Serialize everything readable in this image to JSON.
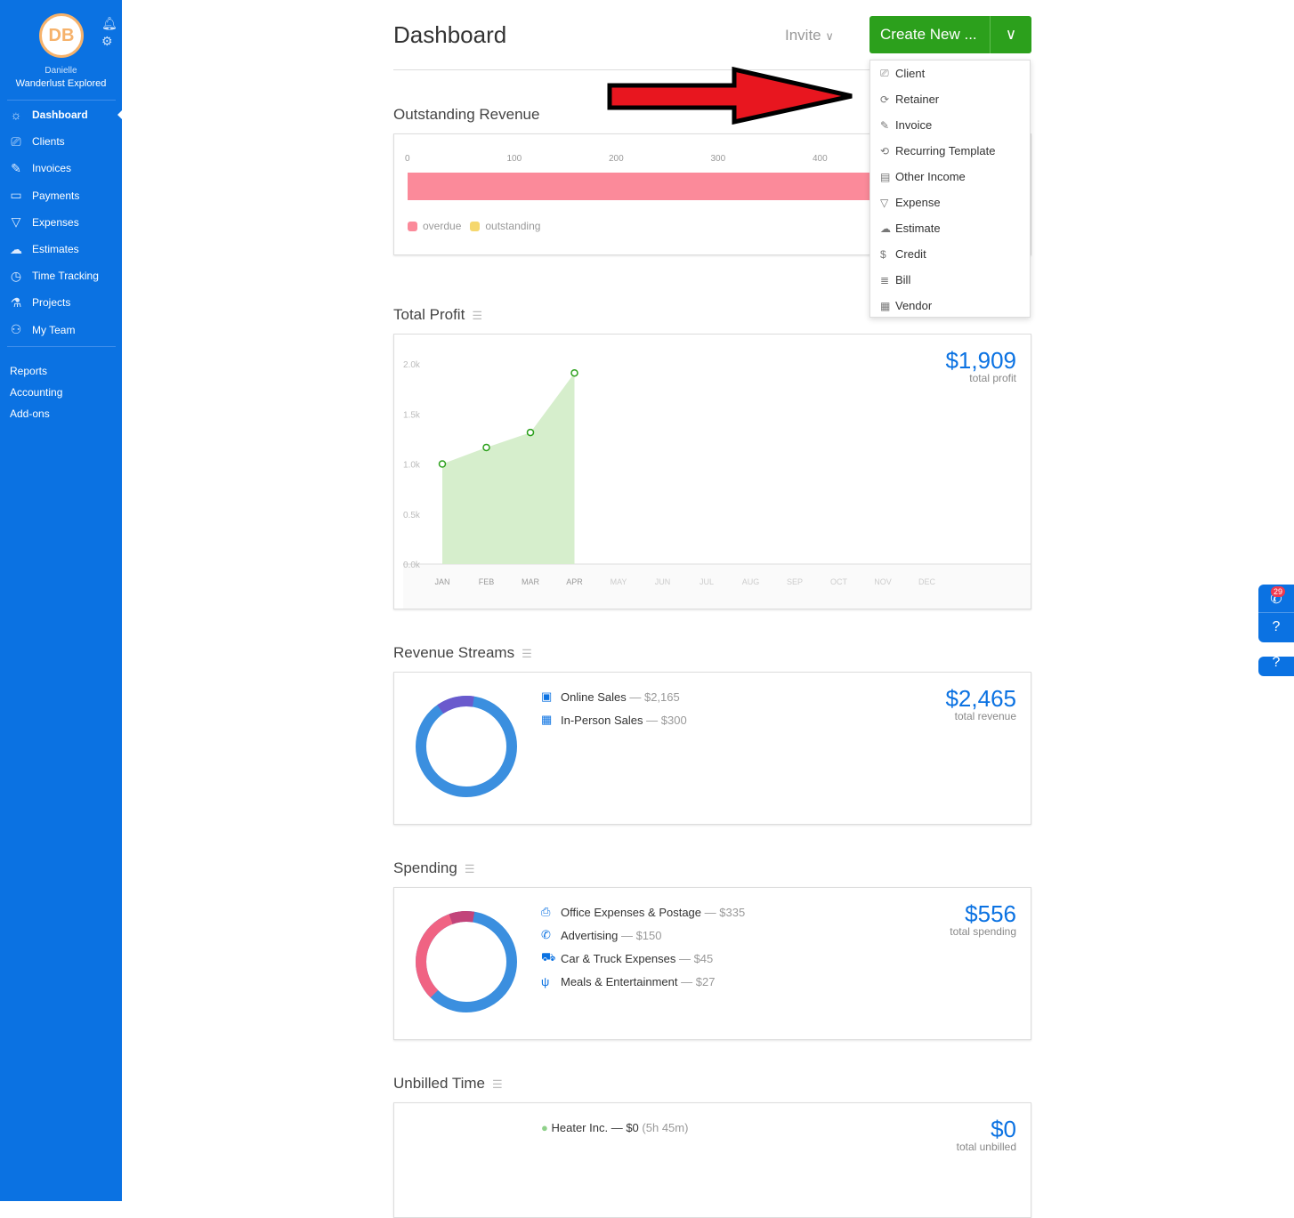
{
  "sidebar": {
    "initials": "DB",
    "user_name": "Danielle",
    "company": "Wanderlust Explored",
    "items": [
      {
        "label": "Dashboard",
        "icon": "sun-icon",
        "glyph": "☼"
      },
      {
        "label": "Clients",
        "icon": "clients-icon",
        "glyph": "⎚"
      },
      {
        "label": "Invoices",
        "icon": "invoice-icon",
        "glyph": "✎"
      },
      {
        "label": "Payments",
        "icon": "wallet-icon",
        "glyph": "▭"
      },
      {
        "label": "Expenses",
        "icon": "expenses-icon",
        "glyph": "▽"
      },
      {
        "label": "Estimates",
        "icon": "estimate-icon",
        "glyph": "☁"
      },
      {
        "label": "Time Tracking",
        "icon": "stopwatch-icon",
        "glyph": "◷"
      },
      {
        "label": "Projects",
        "icon": "flask-icon",
        "glyph": "⚗"
      },
      {
        "label": "My Team",
        "icon": "team-icon",
        "glyph": "⚇"
      }
    ],
    "links": [
      "Reports",
      "Accounting",
      "Add-ons"
    ]
  },
  "header": {
    "title": "Dashboard",
    "invite": "Invite",
    "create_new": "Create New ..."
  },
  "create_menu": [
    {
      "label": "Client",
      "glyph": "⎚"
    },
    {
      "label": "Retainer",
      "glyph": "⟳"
    },
    {
      "label": "Invoice",
      "glyph": "✎"
    },
    {
      "label": "Recurring Template",
      "glyph": "⟲"
    },
    {
      "label": "Other Income",
      "glyph": "▤"
    },
    {
      "label": "Expense",
      "glyph": "▽"
    },
    {
      "label": "Estimate",
      "glyph": "☁"
    },
    {
      "label": "Credit",
      "glyph": "$"
    },
    {
      "label": "Bill",
      "glyph": "≣"
    },
    {
      "label": "Vendor",
      "glyph": "▦"
    }
  ],
  "outstanding": {
    "title": "Outstanding Revenue",
    "ticks": [
      "0",
      "100",
      "200",
      "300",
      "400"
    ],
    "legend": [
      "overdue",
      "outstanding"
    ],
    "colors": {
      "overdue": "#fb8a9a",
      "outstanding": "#f5d76e"
    }
  },
  "chart_data": {
    "type": "area",
    "title": "Total Profit",
    "categories": [
      "JAN",
      "FEB",
      "MAR",
      "APR",
      "MAY",
      "JUN",
      "JUL",
      "AUG",
      "SEP",
      "OCT",
      "NOV",
      "DEC"
    ],
    "values": [
      1000,
      1165,
      1315,
      1909
    ],
    "ylim": [
      0,
      2000
    ],
    "yticks": [
      "0.0k",
      "0.5k",
      "1.0k",
      "1.5k",
      "2.0k"
    ],
    "color": "#d6eecc",
    "point_color": "#2ca01c"
  },
  "profit": {
    "title": "Total Profit",
    "amount": "$1,909",
    "sub": "total profit"
  },
  "revenue": {
    "title": "Revenue Streams",
    "amount": "$2,465",
    "sub": "total revenue",
    "items": [
      {
        "label": "Online Sales",
        "value": "$2,165",
        "glyph": "▣"
      },
      {
        "label": "In-Person Sales",
        "value": "$300",
        "glyph": "▦"
      }
    ]
  },
  "spending": {
    "title": "Spending",
    "amount": "$556",
    "sub": "total spending",
    "items": [
      {
        "label": "Office Expenses & Postage",
        "value": "$335",
        "glyph": "⎙"
      },
      {
        "label": "Advertising",
        "value": "$150",
        "glyph": "✆"
      },
      {
        "label": "Car & Truck Expenses",
        "value": "$45",
        "glyph": "⛟"
      },
      {
        "label": "Meals & Entertainment",
        "value": "$27",
        "glyph": "ψ"
      }
    ]
  },
  "unbilled": {
    "title": "Unbilled Time",
    "amount": "$0",
    "sub": "total unbilled",
    "client": "Heater Inc.",
    "sep": "—",
    "value": "$0",
    "hours": "(5h 45m)"
  },
  "widget": {
    "badge": "29"
  }
}
